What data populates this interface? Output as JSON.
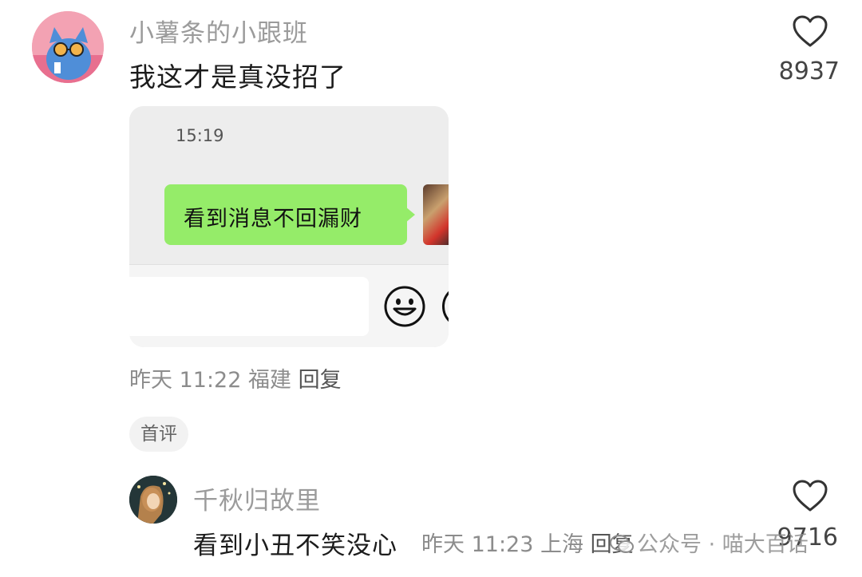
{
  "comment1": {
    "username": "小薯条的小跟班",
    "content": "我这才是真没招了",
    "likes": "8937",
    "image": {
      "timestamp": "15:19",
      "message": "看到消息不回漏财",
      "bubble_color": "#95ec69"
    },
    "time": "昨天 11:22",
    "location": "福建",
    "reply_label": "回复",
    "icons": [
      "heart-icon",
      "smiley-icon"
    ]
  },
  "badge": {
    "label": "首评"
  },
  "comment2": {
    "username": "千秋归故里",
    "content": "看到小丑不笑没心",
    "time": "昨天 11:23",
    "location": "上海",
    "reply_label": "回复",
    "likes": "9716",
    "icons": [
      "heart-icon"
    ]
  },
  "watermark": {
    "text": "公众号 · 喵大百话",
    "icon": "wechat-icon"
  }
}
